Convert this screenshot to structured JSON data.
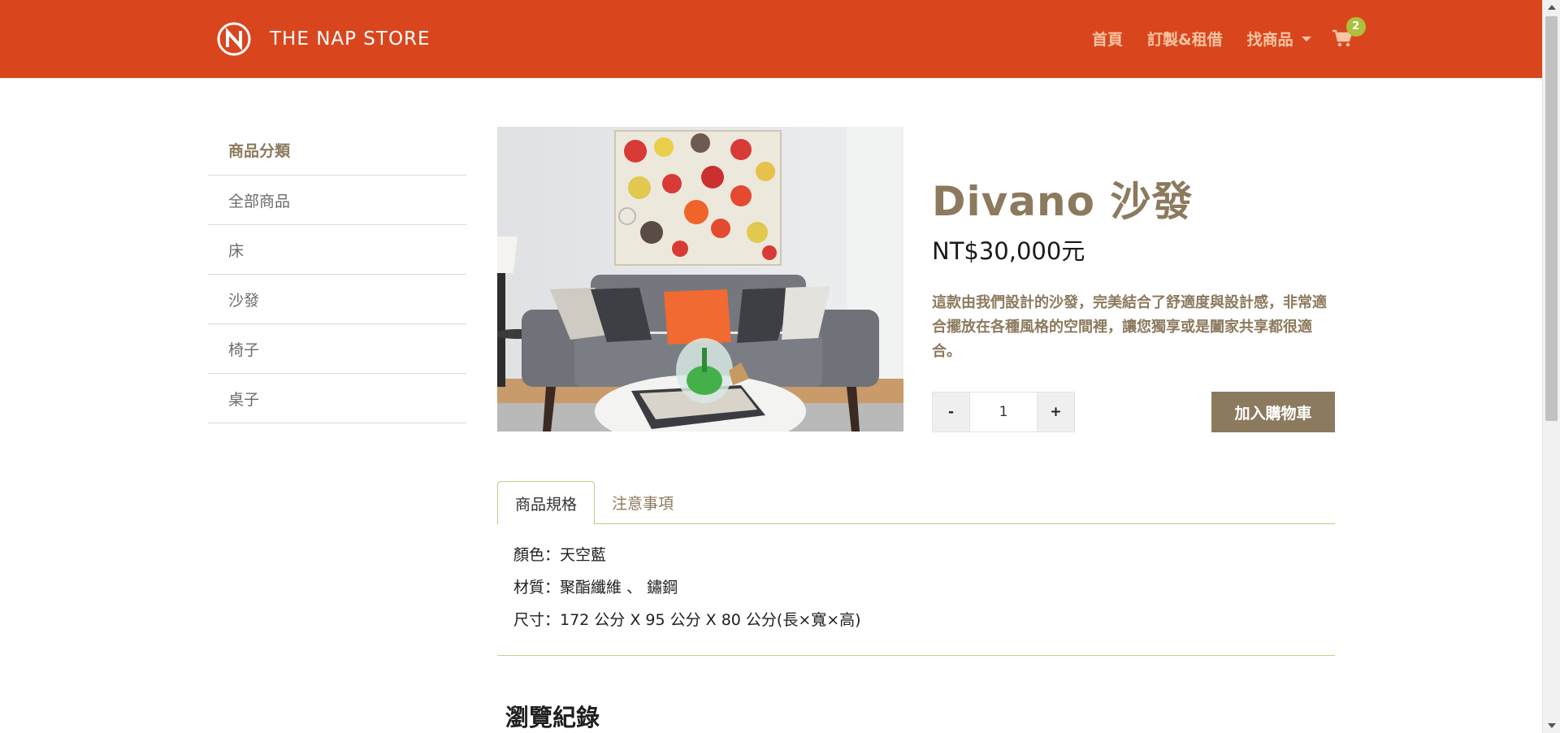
{
  "header": {
    "brand_name": "THE NAP STORE",
    "brand_logo_letter": "N",
    "nav": {
      "home": "首頁",
      "custom_rent": "訂製&租借",
      "find_products": "找商品"
    },
    "cart_count": "2",
    "colors": {
      "bar": "#d9461e",
      "badge": "#aebf3c"
    }
  },
  "sidebar": {
    "heading": "商品分類",
    "items": [
      "全部商品",
      "床",
      "沙發",
      "椅子",
      "桌子"
    ]
  },
  "product": {
    "title": "Divano 沙發",
    "price": "NT$30,000元",
    "description": "這款由我們設計的沙發，完美結合了舒適度與設計感，非常適合擺放在各種風格的空間裡，讓您獨享或是闔家共享都很適合。",
    "quantity": {
      "minus": "-",
      "value": "1",
      "plus": "+"
    },
    "add_to_cart": "加入購物車"
  },
  "tabs": {
    "specs": "商品規格",
    "notes": "注意事項"
  },
  "specs": [
    "顏色：天空藍",
    "材質：聚酯纖維 、 鏽鋼",
    "尺寸：172 公分 X 95 公分 X 80 公分(長×寬×高)"
  ],
  "history_title": "瀏覽紀錄"
}
